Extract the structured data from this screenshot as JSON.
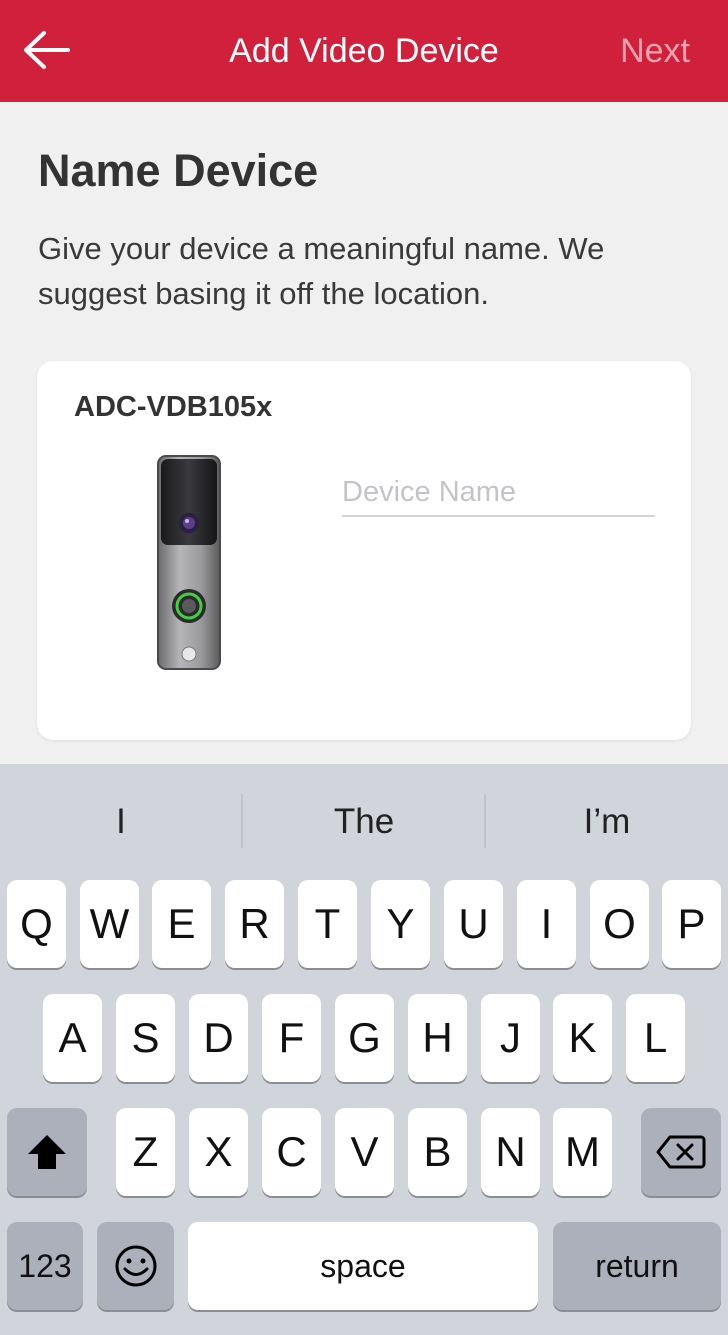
{
  "header": {
    "title": "Add Video Device",
    "next_label": "Next",
    "back_icon": "arrow-left-icon"
  },
  "main": {
    "heading": "Name Device",
    "description": "Give your device a meaningful name. We suggest basing it off the location."
  },
  "device_card": {
    "model": "ADC-VDB105x",
    "name_input": {
      "value": "",
      "placeholder": "Device Name"
    }
  },
  "keyboard": {
    "suggestions": [
      "I",
      "The",
      "I’m"
    ],
    "row1": [
      "Q",
      "W",
      "E",
      "R",
      "T",
      "Y",
      "U",
      "I",
      "O",
      "P"
    ],
    "row2": [
      "A",
      "S",
      "D",
      "F",
      "G",
      "H",
      "J",
      "K",
      "L"
    ],
    "row3": [
      "Z",
      "X",
      "C",
      "V",
      "B",
      "N",
      "M"
    ],
    "numbers_label": "123",
    "space_label": "space",
    "return_label": "return",
    "shift_icon": "shift-icon",
    "delete_icon": "backspace-icon",
    "emoji_icon": "emoji-icon"
  },
  "colors": {
    "header_bg": "#d0203c",
    "next_disabled": "#f3a4b1",
    "keyboard_bg": "#d1d4da"
  }
}
